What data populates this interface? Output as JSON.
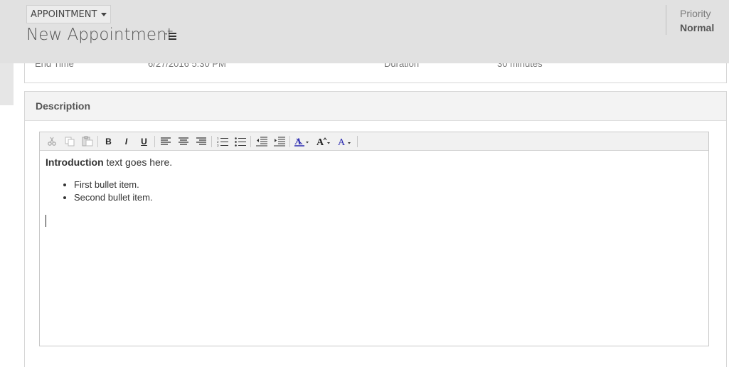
{
  "header": {
    "entity_label": "APPOINTMENT",
    "record_title": "New Appointment",
    "priority_label": "Priority",
    "priority_value": "Normal"
  },
  "details": {
    "end_time_label": "End Time",
    "end_time_value": "6/27/2016 5:30 PM",
    "duration_label": "Duration",
    "duration_value": "30 minutes"
  },
  "description": {
    "section_title": "Description",
    "toolbar_icons": [
      "cut-icon",
      "copy-icon",
      "paste-icon",
      "bold-icon",
      "italic-icon",
      "underline-icon",
      "align-left-icon",
      "align-center-icon",
      "align-right-icon",
      "numbered-list-icon",
      "bulleted-list-icon",
      "decrease-indent-icon",
      "increase-indent-icon",
      "highlight-color-icon",
      "font-size-icon",
      "font-color-icon"
    ],
    "bold_label": "B",
    "italic_label": "I",
    "underline_label": "U",
    "intro_bold": "Introduction",
    "intro_rest": " text goes here.",
    "bullets": [
      "First bullet item.",
      "Second bullet item."
    ]
  },
  "colors": {
    "header_bg": "#e1e1e1",
    "accent_blue": "#2b2bb0"
  }
}
